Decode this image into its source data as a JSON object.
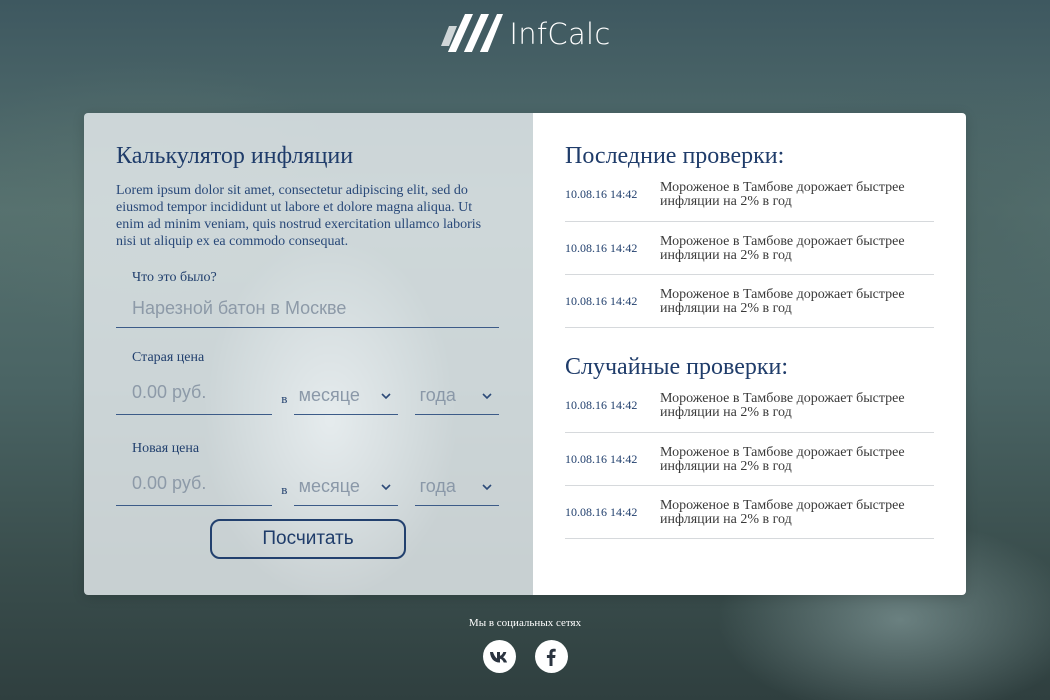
{
  "logo": {
    "text": "InfCalc"
  },
  "calculator": {
    "title": "Калькулятор инфляции",
    "description": "Lorem ipsum dolor sit amet, consectetur adipiscing elit, sed do eiusmod tempor incididunt ut labore et dolore magna aliqua. Ut enim ad minim veniam, quis nostrud exercitation ullamco laboris nisi ut aliquip ex ea commodo consequat.",
    "item_label": "Что это было?",
    "item_placeholder": "Нарезной батон в Москве",
    "old_price": {
      "label": "Старая цена",
      "placeholder": "0.00 руб.",
      "in_word": "в",
      "month": "месяце",
      "year": "года"
    },
    "new_price": {
      "label": "Новая цена",
      "placeholder": "0.00 руб.",
      "in_word": "в",
      "month": "месяце",
      "year": "года"
    },
    "submit_label": "Посчитать"
  },
  "latest": {
    "title": "Последние проверки:",
    "items": [
      {
        "date": "10.08.16 14:42",
        "text": "Мороженое в Тамбове дорожает быстрее инфляции на 2% в год"
      },
      {
        "date": "10.08.16 14:42",
        "text": "Мороженое в Тамбове дорожает быстрее инфляции на 2% в год"
      },
      {
        "date": "10.08.16 14:42",
        "text": "Мороженое в Тамбове дорожает быстрее инфляции на 2% в год"
      }
    ]
  },
  "random": {
    "title": "Случайные проверки:",
    "items": [
      {
        "date": "10.08.16 14:42",
        "text": "Мороженое в Тамбове дорожает быстрее инфляции на 2% в год"
      },
      {
        "date": "10.08.16 14:42",
        "text": "Мороженое в Тамбове дорожает быстрее инфляции на 2% в год"
      },
      {
        "date": "10.08.16 14:42",
        "text": "Мороженое в Тамбове дорожает быстрее инфляции на 2% в год"
      }
    ]
  },
  "social": {
    "label": "Мы в социальных сетях",
    "vk_icon": "vk-icon",
    "facebook_icon": "facebook-icon"
  },
  "colors": {
    "accent": "#1f3c6a",
    "card_right_bg": "#ffffff",
    "divider": "#d6d9dc"
  }
}
